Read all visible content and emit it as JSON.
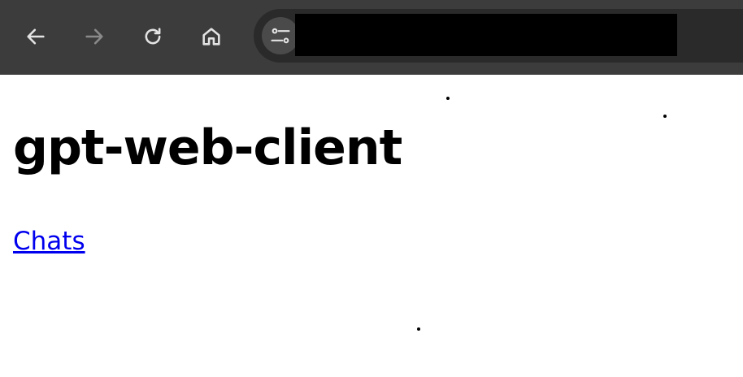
{
  "browser": {
    "url_value": "",
    "icons": {
      "back": "arrow-left-icon",
      "forward": "arrow-right-icon",
      "reload": "reload-icon",
      "home": "home-icon",
      "site_info": "tune-icon"
    },
    "colors": {
      "toolbar": "#3c3c3c",
      "omnibox": "#2a2a2a",
      "icon_active": "#e3e3e3",
      "icon_disabled": "#8a8a8a",
      "url_redaction": "#000000"
    }
  },
  "page": {
    "title": "gpt-web-client",
    "links": [
      {
        "label": "Chats"
      }
    ],
    "colors": {
      "background": "#ffffff",
      "text": "#000000",
      "link": "#0000ee"
    }
  }
}
